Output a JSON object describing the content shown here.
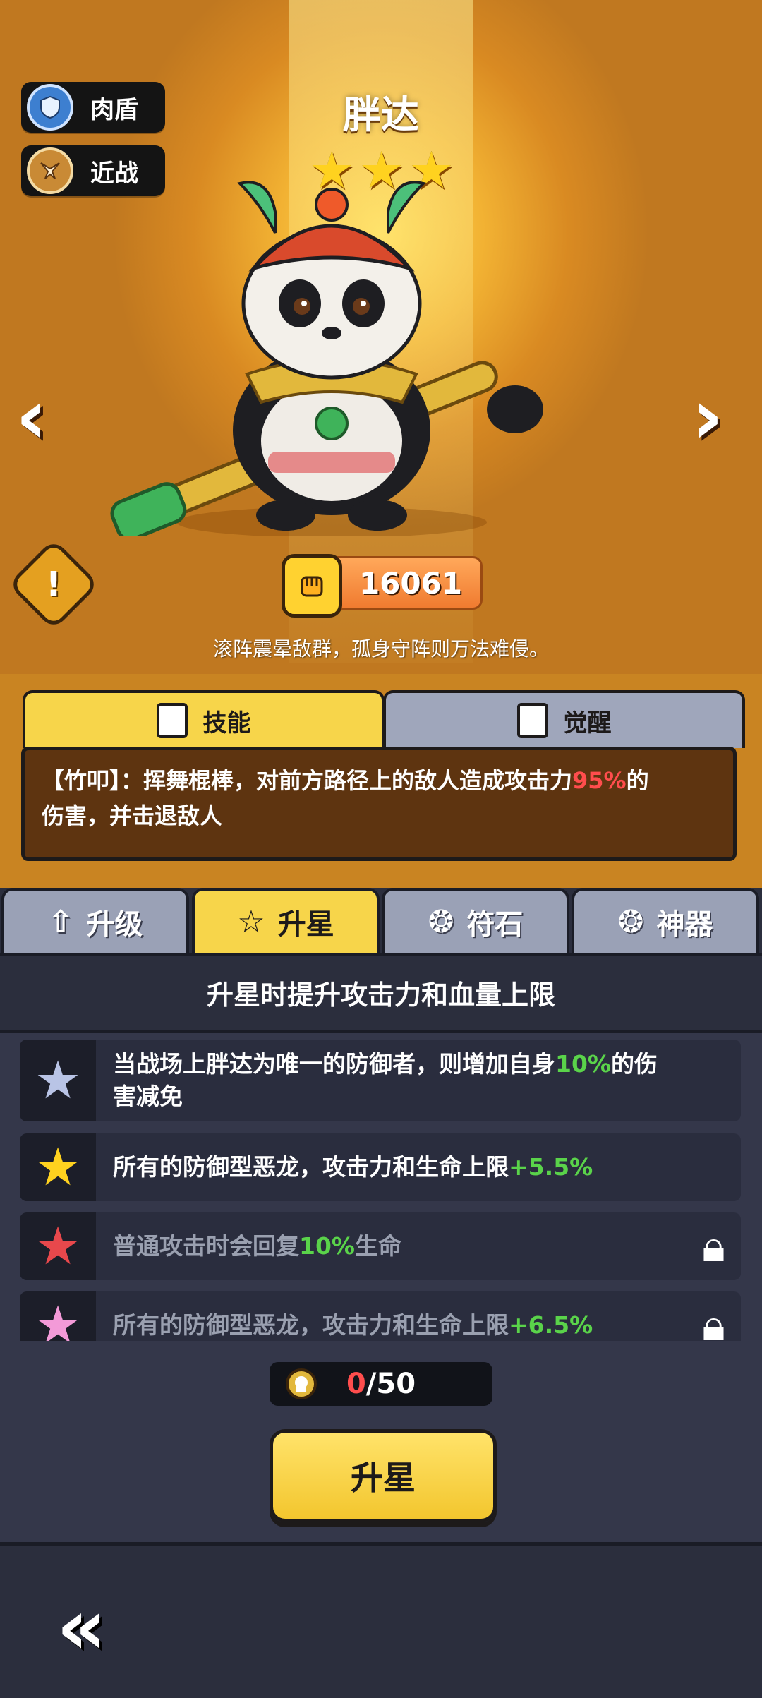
{
  "hero": {
    "name": "胖达",
    "roles": [
      {
        "label": "肉盾",
        "icon": "shield-icon"
      },
      {
        "label": "近战",
        "icon": "melee-icon"
      }
    ],
    "star_count": 3,
    "power": "16061",
    "tagline": "滚阵震晕敌群，孤身守阵则万法难侵。"
  },
  "skill_tabs": [
    {
      "label": "技能",
      "active": true
    },
    {
      "label": "觉醒",
      "active": false
    }
  ],
  "skill": {
    "line_a": "【竹叩】：挥舞棍棒，对前方路径上的敌人造成攻击力",
    "highlight": "95%",
    "line_b": "的",
    "line_c": "伤害，并击退敌人"
  },
  "menu_tabs": [
    {
      "label": "升级",
      "icon": "arrow-up-icon",
      "active": false
    },
    {
      "label": "升星",
      "icon": "star-outline-icon",
      "active": true
    },
    {
      "label": "符石",
      "icon": "rune-icon",
      "active": false
    },
    {
      "label": "神器",
      "icon": "artifact-icon",
      "active": false
    }
  ],
  "section_title": "升星时提升攻击力和血量上限",
  "star_bonuses": [
    {
      "pre": "当战场上胖达为唯一的防御者，则增加自身",
      "hl": "10%",
      "post": "的伤",
      "line2": "害减免",
      "star_color": "#b9c4e6",
      "locked": false
    },
    {
      "pre": "所有的防御型恶龙，攻击力和生命上限",
      "hl": "+5.5%",
      "post": "",
      "line2": "",
      "star_color": "#ffd21f",
      "locked": false
    },
    {
      "pre": "普通攻击时会回复",
      "hl": "10%",
      "post": "生命",
      "line2": "",
      "star_color": "#e8484c",
      "locked": true
    },
    {
      "pre": "所有的防御型恶龙，攻击力和生命上限",
      "hl": "+6.5%",
      "post": "",
      "line2": "",
      "star_color": "#f39ad8",
      "locked": true
    }
  ],
  "material": {
    "current": "0",
    "separator": "/",
    "required": "50"
  },
  "upgrade_button": "升星"
}
